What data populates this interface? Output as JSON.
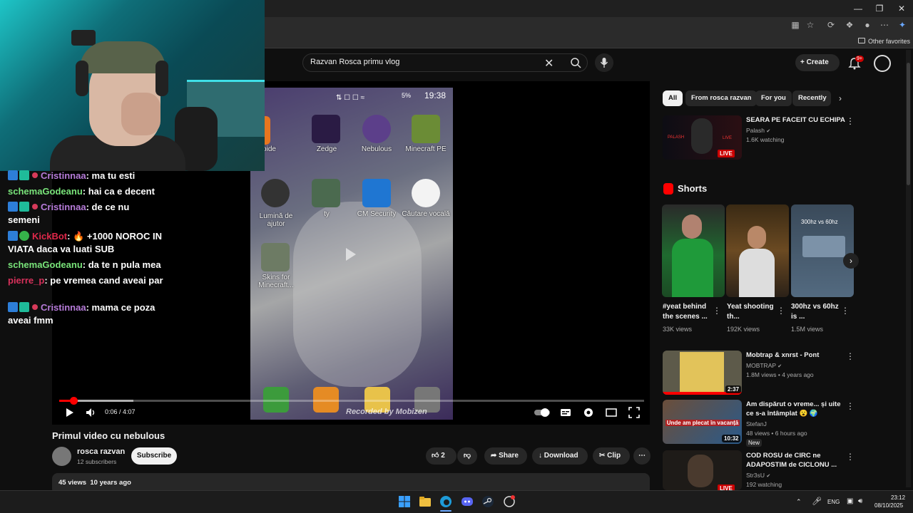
{
  "browser": {
    "favorites_label": "Other favorites"
  },
  "search": {
    "query": "Razvan Rosca primu vlog"
  },
  "header": {
    "create_label": "Create",
    "notification_count": "9+"
  },
  "chat": [
    {
      "user": "Cristinnaa",
      "user_color": "#b67bd9",
      "badges": true,
      "heart": true,
      "text": "ma tu esti"
    },
    {
      "user": "schemaGodeanu",
      "user_color": "#79e47a",
      "badges": false,
      "heart": false,
      "text": "hai ca e decent"
    },
    {
      "user": "Cristinnaa",
      "user_color": "#b67bd9",
      "badges": true,
      "heart": true,
      "text": "de ce nu semeni"
    },
    {
      "user": "KickBot",
      "user_color": "#e0284a",
      "badges": true,
      "heart": false,
      "text": "🔥 +1000 NOROC IN VIATA daca va luati SUB"
    },
    {
      "user": "schemaGodeanu",
      "user_color": "#79e47a",
      "badges": false,
      "heart": false,
      "text": "da te n pula mea"
    },
    {
      "user": "pierre_p",
      "user_color": "#d8315b",
      "badges": false,
      "heart": false,
      "text": "pe vremea cand aveai par"
    },
    {
      "user": "Cristinnaa",
      "user_color": "#b67bd9",
      "badges": true,
      "heart": true,
      "text": "mama ce poza aveai fmm"
    }
  ],
  "phone": {
    "time": "19:38",
    "battery": "5%",
    "apps_row1": [
      "Aptoide",
      "Zedge",
      "Nebulous",
      "Minecraft PE"
    ],
    "apps_row2": [
      "Lumină de ajutor",
      "ty",
      "CM Security",
      "Căutare vocală"
    ],
    "apps_row3": [
      "Skins for Minecraft..."
    ],
    "watermark": "Recorded by Mobizen"
  },
  "player": {
    "time": "0:06 / 4:07",
    "progress": 0.024
  },
  "video": {
    "title": "Primul video cu nebulous",
    "channel": "rosca razvan",
    "subscribers": "12 subscribers",
    "subscribe_label": "Subscribe",
    "likes": "2",
    "share_label": "Share",
    "download_label": "Download",
    "clip_label": "Clip",
    "views": "45 views",
    "age": "10 years ago"
  },
  "chips": [
    {
      "label": "All",
      "active": true
    },
    {
      "label": "From rosca razvan",
      "active": false
    },
    {
      "label": "For you",
      "active": false
    },
    {
      "label": "Recently",
      "active": false
    }
  ],
  "shorts_heading": "Shorts",
  "shorts": [
    {
      "title": "#yeat behind the scenes ...",
      "views": "33K views"
    },
    {
      "title": "Yeat shooting th...",
      "views": "192K views"
    },
    {
      "title": "300hz vs 60hz is ...",
      "views": "1.5M views",
      "overlay": "300hz vs 60hz"
    }
  ],
  "recommended_top": {
    "title": "SEARA PE FACEIT CU ECHIPA",
    "channel": "Palash",
    "meta": "1.6K watching",
    "badge": "LIVE",
    "thumb_text": "PALASH",
    "thumb_text2": "LIVE"
  },
  "recommended": [
    {
      "title": "Mobtrap & xnrst - Pont",
      "channel": "MOBTRAP",
      "meta": "1.8M views • 4 years ago",
      "duration": "2:37"
    },
    {
      "title": "Am dispărut o vreme... și uite ce s-a întâmplat 😮 🌍",
      "channel": "StefanJ",
      "meta": "48 views • 6 hours ago",
      "duration": "10:32",
      "tag": "New",
      "thumb_text": "Unde am plecat în vacanță"
    },
    {
      "title": "COD ROSU de CIRC ne ADAPOSTIM de CICLONU ...",
      "channel": "Str3sU",
      "meta": "192 watching",
      "duration": "LIVE"
    }
  ],
  "taskbar": {
    "lang": "ENG",
    "time": "23:12",
    "date": "08/10/2025"
  },
  "colors": {
    "accent_red": "#ff0000",
    "bg": "#0f0f0f",
    "chip_bg": "#272727"
  }
}
